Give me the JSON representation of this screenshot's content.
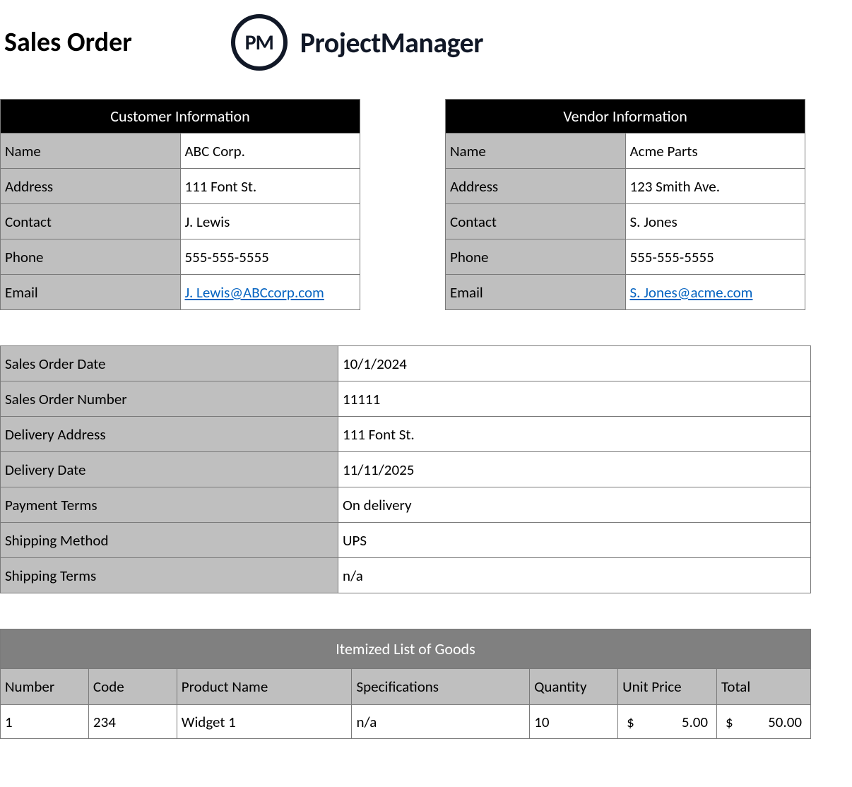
{
  "header": {
    "title": "Sales Order",
    "logo_initials": "PM",
    "logo_text": "ProjectManager"
  },
  "customer": {
    "section_title": "Customer Information",
    "rows": [
      {
        "label": "Name",
        "value": "ABC Corp."
      },
      {
        "label": "Address",
        "value": "111 Font St."
      },
      {
        "label": "Contact",
        "value": "J. Lewis"
      },
      {
        "label": "Phone",
        "value": "555-555-5555"
      },
      {
        "label": "Email",
        "value": "J. Lewis@ABCcorp.com",
        "is_email": true
      }
    ]
  },
  "vendor": {
    "section_title": "Vendor Information",
    "rows": [
      {
        "label": "Name",
        "value": "Acme Parts"
      },
      {
        "label": "Address",
        "value": "123 Smith Ave."
      },
      {
        "label": "Contact",
        "value": "S. Jones"
      },
      {
        "label": "Phone",
        "value": "555-555-5555"
      },
      {
        "label": "Email",
        "value": "S. Jones@acme.com",
        "is_email": true
      }
    ]
  },
  "order_details": [
    {
      "label": "Sales Order Date",
      "value": "10/1/2024"
    },
    {
      "label": "Sales Order Number",
      "value": "11111"
    },
    {
      "label": "Delivery Address",
      "value": "111 Font St."
    },
    {
      "label": "Delivery Date",
      "value": "11/11/2025"
    },
    {
      "label": "Payment Terms",
      "value": "On delivery"
    },
    {
      "label": "Shipping Method",
      "value": "UPS"
    },
    {
      "label": "Shipping Terms",
      "value": "n/a"
    }
  ],
  "goods": {
    "section_title": "Itemized List of Goods",
    "columns": [
      "Number",
      "Code",
      "Product Name",
      "Specifications",
      "Quantity",
      "Unit Price",
      "Total"
    ],
    "rows": [
      {
        "number": "1",
        "code": "234",
        "product": "Widget 1",
        "spec": "n/a",
        "qty": "10",
        "unit_currency": "$",
        "unit_price": "5.00",
        "total_currency": "$",
        "total": "50.00"
      }
    ]
  }
}
